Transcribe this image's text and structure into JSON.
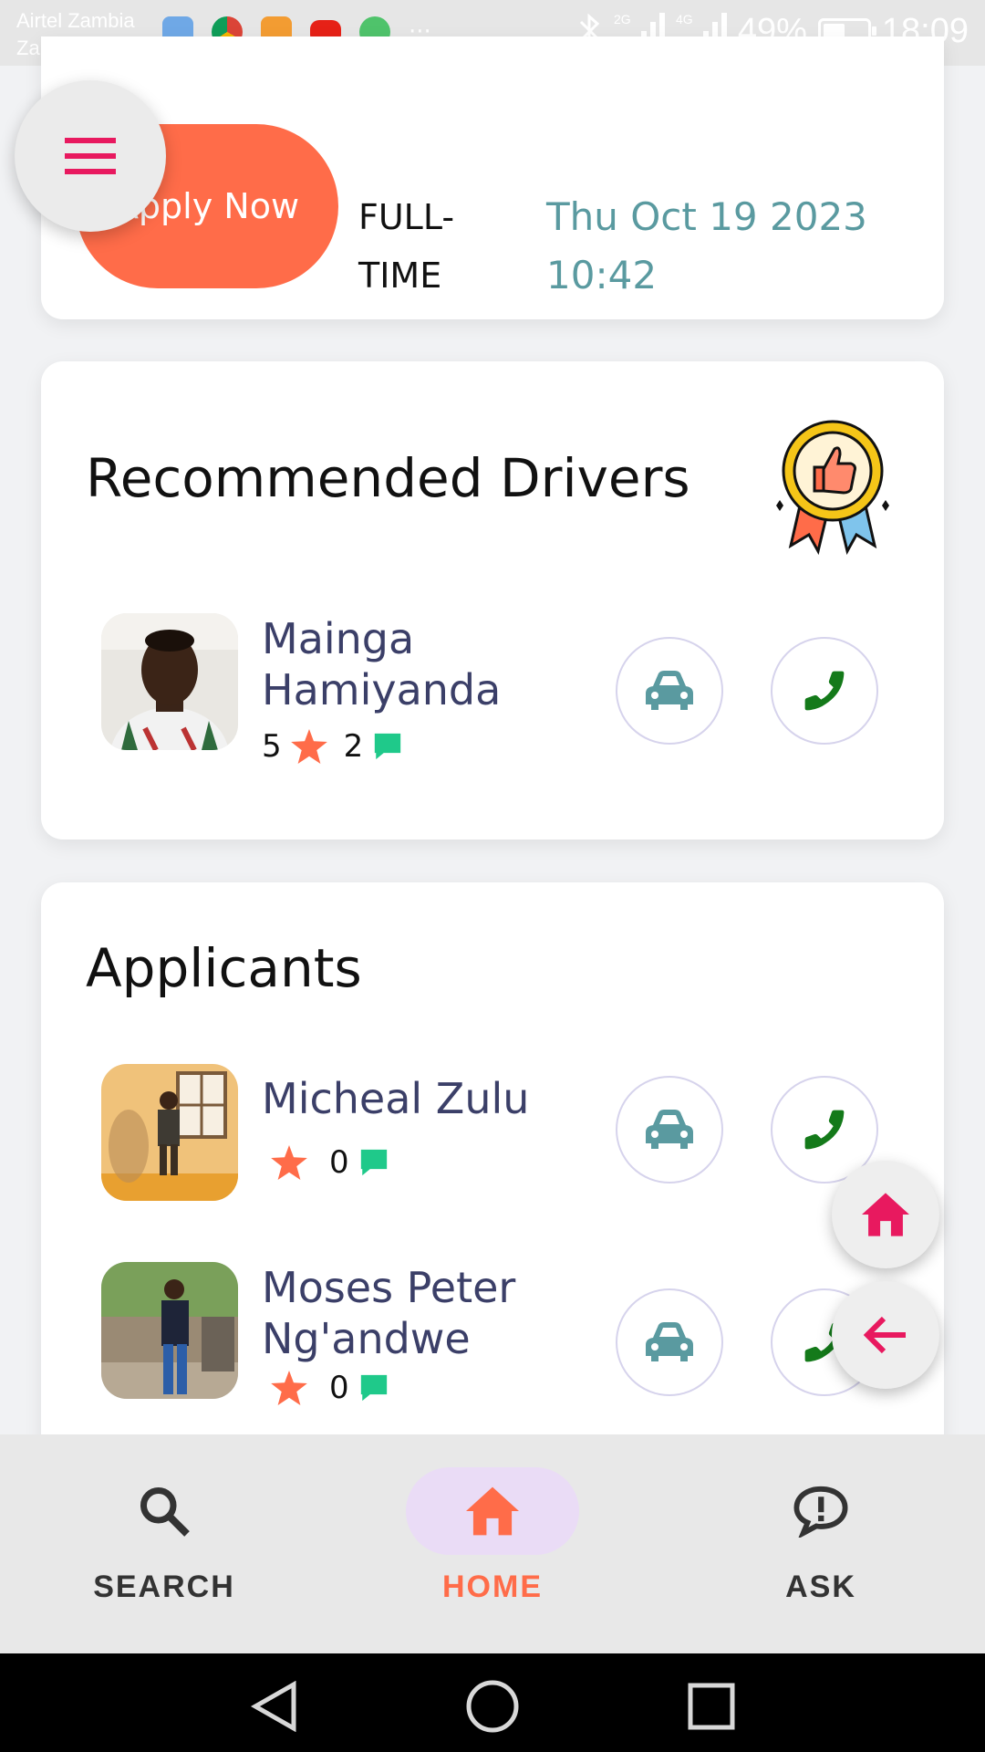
{
  "status_bar": {
    "carrier_1": "Airtel Zambia",
    "carrier_2": "Zamtel",
    "battery_percent": "49%",
    "battery_level": 0.49,
    "time": "18:09",
    "net_1": "2G",
    "net_2": "4G",
    "overflow": "···",
    "app_icons": [
      "messenger-icon",
      "chrome-icon",
      "app-icon",
      "youtube-icon",
      "business-whatsapp-icon"
    ]
  },
  "job": {
    "apply_label": "Apply Now",
    "type": "FULL-TIME",
    "date": "Thu Oct 19 2023 10:42"
  },
  "recommended": {
    "title": "Recommended Drivers",
    "drivers": [
      {
        "name": "Mainga Hamiyanda",
        "rating": "5",
        "comments": "2"
      }
    ]
  },
  "applicants": {
    "title": "Applicants",
    "items": [
      {
        "name": "Micheal Zulu",
        "rating": "",
        "comments": "0"
      },
      {
        "name": "Moses Peter Ng'andwe",
        "rating": "",
        "comments": "0"
      }
    ]
  },
  "bottom_nav": {
    "items": [
      {
        "label": "SEARCH",
        "icon": "search-icon",
        "active": false
      },
      {
        "label": "HOME",
        "icon": "home-icon",
        "active": true
      },
      {
        "label": "ASK",
        "icon": "ask-icon",
        "active": false
      }
    ]
  },
  "colors": {
    "accent": "#ff6c49",
    "pink": "#e8195f",
    "teal": "#5a9aa0",
    "name": "#3b3f68",
    "phone_green": "#147a1a",
    "comment_green": "#1fc98a",
    "nav_active_bg": "#eadcf6"
  }
}
